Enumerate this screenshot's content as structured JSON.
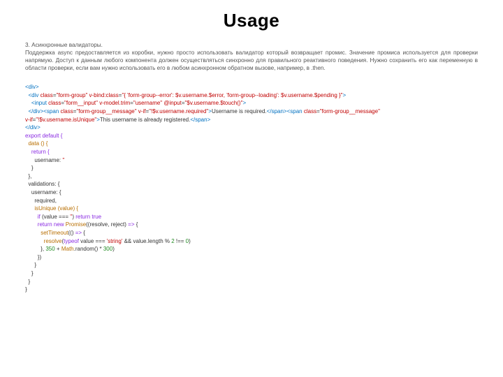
{
  "title": "Usage",
  "intro": "3. Асинхронные валидаторы.\nПоддержка async предоставляется из коробки, нужно просто использовать валидатор который возвращает промис. Значение промиса используется для проверки напрямую. Доступ к данным любого компонента должен осуществляться синхронно для правильного реактивного поведения. Нужно сохранить его как переменную в области проверки, если вам нужно использовать его в любом асинхронном обратном вызове, например, в .then.",
  "code": {
    "l1a": "<",
    "l1b": "div",
    "l1c": ">",
    "l2a": "  <",
    "l2b": "div",
    "l2c": " class",
    "l2d": "=",
    "l2e": "\"form-group\"",
    "l2f": " v-bind:class",
    "l2g": "=",
    "l2h": "\"{ 'form-group--error': $v.username.$error, 'form-group--loading': $v.username.$pending }\"",
    "l2i": ">",
    "l3a": "    <",
    "l3b": "input",
    "l3c": " class",
    "l3d": "=",
    "l3e": "\"form__input\"",
    "l3f": " v-model.trim",
    "l3g": "=",
    "l3h": "\"username\"",
    "l3i": " @input",
    "l3j": "=",
    "l3k": "\"$v.username.$touch()\"",
    "l3l": ">",
    "l4a": "  </",
    "l4b": "div",
    "l4c": "><",
    "l4d": "span",
    "l4e": " class",
    "l4f": "=",
    "l4g": "\"form-group__message\"",
    "l4h": " v-if",
    "l4i": "=",
    "l4j": "\"!$v.username.required\"",
    "l4k": ">",
    "l4l": "Username is required.",
    "l4m": "</",
    "l4n": "span",
    "l4o": "><",
    "l4p": "span",
    "l4q": " class",
    "l4r": "=",
    "l4s": "\"form-group__message\"",
    "l5a": "v-if",
    "l5b": "=",
    "l5c": "\"!$v.username.isUnique\"",
    "l5d": ">",
    "l5e": "This username is already registered.",
    "l5f": "</",
    "l5g": "span",
    "l5h": ">",
    "l6a": "</",
    "l6b": "div",
    "l6c": ">",
    "l7": "export default {",
    "l8": "  data () {",
    "l9": "    return {",
    "l10a": "      username: ",
    "l10b": "''",
    "l11": "    }",
    "l12": "  },",
    "l13": "  validations: {",
    "l14": "    username: {",
    "l15": "      required,",
    "l16": "      isUnique (value) {",
    "l17a": "        if",
    "l17b": " (value === ",
    "l17c": "''",
    "l17d": ") ",
    "l17e": "return true",
    "l18a": "        return new",
    "l18b": " Promise",
    "l18c": "((resolve, reject) ",
    "l18d": "=>",
    "l18e": " {",
    "l19a": "          setTimeout",
    "l19b": "(() ",
    "l19c": "=>",
    "l19d": " {",
    "l20a": "            resolve",
    "l20b": "(",
    "l20c": "typeof",
    "l20d": " value === ",
    "l20e": "'string'",
    "l20f": " && value.length % ",
    "l20g": "2",
    "l20h": " !== ",
    "l20i": "0",
    "l20j": ")",
    "l21a": "          }, ",
    "l21b": "350",
    "l21c": " + ",
    "l21d": "Math",
    "l21e": ".random() * ",
    "l21f": "300",
    "l21g": ")",
    "l22": "        })",
    "l23": "      }",
    "l24": "    }",
    "l25": "  }",
    "l26": "}"
  }
}
